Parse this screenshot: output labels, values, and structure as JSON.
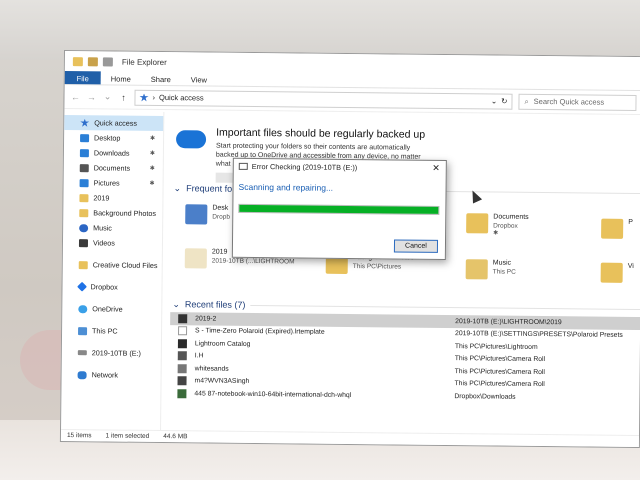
{
  "window": {
    "title": "File Explorer",
    "ribbon_tabs": [
      "File",
      "Home",
      "Share",
      "View"
    ]
  },
  "address": {
    "path": "Quick access",
    "search_placeholder": "Search Quick access"
  },
  "sidebar": {
    "items": [
      {
        "label": "Quick access",
        "icon": "star-icon",
        "pinned": false
      },
      {
        "label": "Desktop",
        "icon": "desktop-folder-icon",
        "pinned": true
      },
      {
        "label": "Downloads",
        "icon": "downloads-icon",
        "pinned": true
      },
      {
        "label": "Documents",
        "icon": "documents-icon",
        "pinned": true
      },
      {
        "label": "Pictures",
        "icon": "pictures-icon",
        "pinned": true
      },
      {
        "label": "2019",
        "icon": "folder-icon",
        "pinned": false
      },
      {
        "label": "Background Photos",
        "icon": "folder-icon",
        "pinned": false
      },
      {
        "label": "Music",
        "icon": "music-icon",
        "pinned": false
      },
      {
        "label": "Videos",
        "icon": "videos-icon",
        "pinned": false
      },
      {
        "label": "Creative Cloud Files",
        "icon": "folder-icon",
        "pinned": false
      },
      {
        "label": "Dropbox",
        "icon": "dropbox-icon",
        "pinned": false
      },
      {
        "label": "OneDrive",
        "icon": "onedrive-icon",
        "pinned": false
      },
      {
        "label": "This PC",
        "icon": "pc-icon",
        "pinned": false
      },
      {
        "label": "2019-10TB (E:)",
        "icon": "drive-icon",
        "pinned": false
      },
      {
        "label": "Network",
        "icon": "network-icon",
        "pinned": false
      }
    ]
  },
  "banner": {
    "heading": "Important files should be regularly backed up",
    "line1": "Start protecting your folders so their contents are automatically",
    "line2": "backed up to OneDrive and accessible from any device, no matter",
    "line3": "what"
  },
  "frequent": {
    "heading": "Frequent folde",
    "tiles": [
      {
        "name": "Desk",
        "sub": "Dropb"
      },
      {
        "name": "Documents",
        "sub": "Dropbox"
      },
      {
        "name": "P",
        "sub": ""
      },
      {
        "name": "2019",
        "sub": "2019-10TB (...\\LIGHTROOM"
      },
      {
        "name": "Background Photos",
        "sub": "This PC\\Pictures"
      },
      {
        "name": "Music",
        "sub": "This PC"
      },
      {
        "name": "Vi",
        "sub": ""
      }
    ]
  },
  "recent": {
    "heading": "Recent files (7)",
    "rows": [
      {
        "name": "2019-2",
        "path": "2019-10TB (E:)\\LIGHTROOM\\2019"
      },
      {
        "name": "S - Time-Zero Polaroid (Expired).lrtemplate",
        "path": "2019-10TB (E:)\\SETTINGS\\PRESETS\\Polaroid Presets"
      },
      {
        "name": "Lightroom Catalog",
        "path": "This PC\\Pictures\\Lightroom"
      },
      {
        "name": "I.H",
        "path": "This PC\\Pictures\\Camera Roll"
      },
      {
        "name": "whitesands",
        "path": "This PC\\Pictures\\Camera Roll"
      },
      {
        "name": "m4?WVN3ASingh",
        "path": "This PC\\Pictures\\Camera Roll"
      },
      {
        "name": "445 87-notebook-win10-64bit-international-dch-whql",
        "path": "Dropbox\\Downloads"
      }
    ]
  },
  "status": {
    "items": "15 items",
    "selected": "1 item selected",
    "size": "44.6 MB"
  },
  "dialog": {
    "title": "Error Checking (2019-10TB (E:))",
    "message": "Scanning and repairing...",
    "progress": 1.0,
    "cancel_label": "Cancel",
    "progress_color": "#06b025"
  }
}
